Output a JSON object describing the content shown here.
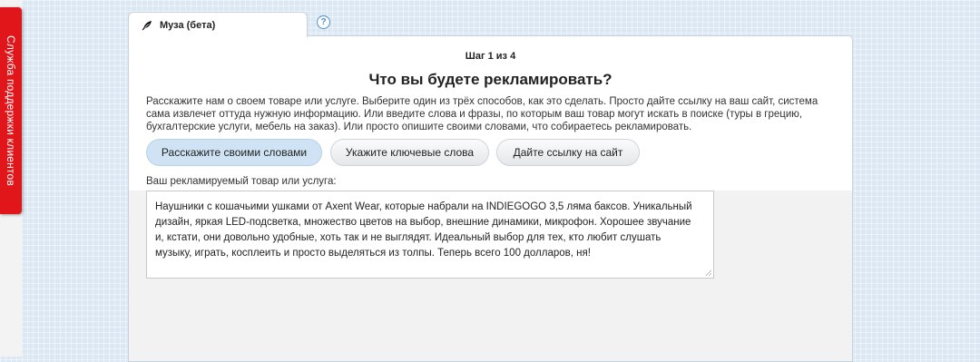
{
  "support_tab": {
    "label": "Служба поддержки клиентов"
  },
  "tabs": {
    "muza_label": "Муза (бета)",
    "help_label": "?"
  },
  "wizard": {
    "step": "Шаг 1 из 4",
    "headline": "Что вы будете рекламировать?",
    "intro": "Расскажите нам о своем товаре или услуге. Выберите один из трёх способов, как это сделать. Просто дайте ссылку на ваш сайт, система сама извлечет оттуда нужную информацию. Или введите слова и фразы, по которым ваш товар могут искать в поиске (туры в грецию, бухгалтерские услуги, мебель на заказ). Или просто опишите своими словами, что собираетесь рекламировать.",
    "choices": {
      "words": "Расскажите своими словами",
      "keywords": "Укажите ключевые слова",
      "link": "Дайте ссылку на сайт"
    },
    "selected_choice": "Расскажите своими словами",
    "field_label": "Ваш рекламируемый товар или услуга:",
    "field_value": "Наушники с кошачьими ушками от Axent Wear, которые набрали на INDIEGOGO 3,5 лямa баксов. Уникальный дизайн, яркая LED-подсветка, множество цветов на выбор, внешние динамики, микрофон. Хорошее звучание и, кстати, они довольно удобные, хоть так и не выглядят. Идеальный выбор для тех, кто любит слушать музыку, играть, косплеить и просто выделяться из толпы. Теперь всего 100 долларов, ня!"
  },
  "colors": {
    "support_tab": "#e0161b",
    "selected_choice": "#cfe3f4",
    "background": "#dbe8f3"
  }
}
